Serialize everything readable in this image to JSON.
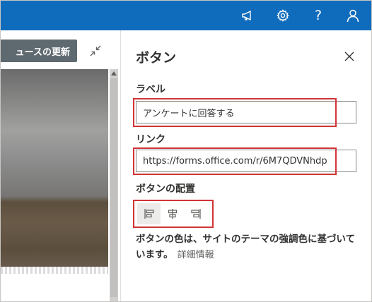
{
  "topbar": {
    "background": "#0f6cbd",
    "icons": [
      "megaphone-icon",
      "gear-icon",
      "help-icon",
      "person-icon"
    ],
    "help_label": "?"
  },
  "left_pane": {
    "news_button_label": "ュースの更新",
    "collapse_icon": "collapse-arrows-icon"
  },
  "panel": {
    "title": "ボタン",
    "close_icon": "close-icon",
    "label_field": {
      "label": "ラベル",
      "value": "アンケートに回答する"
    },
    "link_field": {
      "label": "リンク",
      "value": "https://forms.office.com/r/6M7QDVNhdp"
    },
    "alignment": {
      "label": "ボタンの配置",
      "options": [
        "align-left-icon",
        "align-center-icon",
        "align-right-icon"
      ],
      "selected": "align-left-icon"
    },
    "note_text": "ボタンの色は、サイトのテーマの強調色に基づいています。",
    "note_link": "詳細情報"
  },
  "highlight_color": "#d13438"
}
